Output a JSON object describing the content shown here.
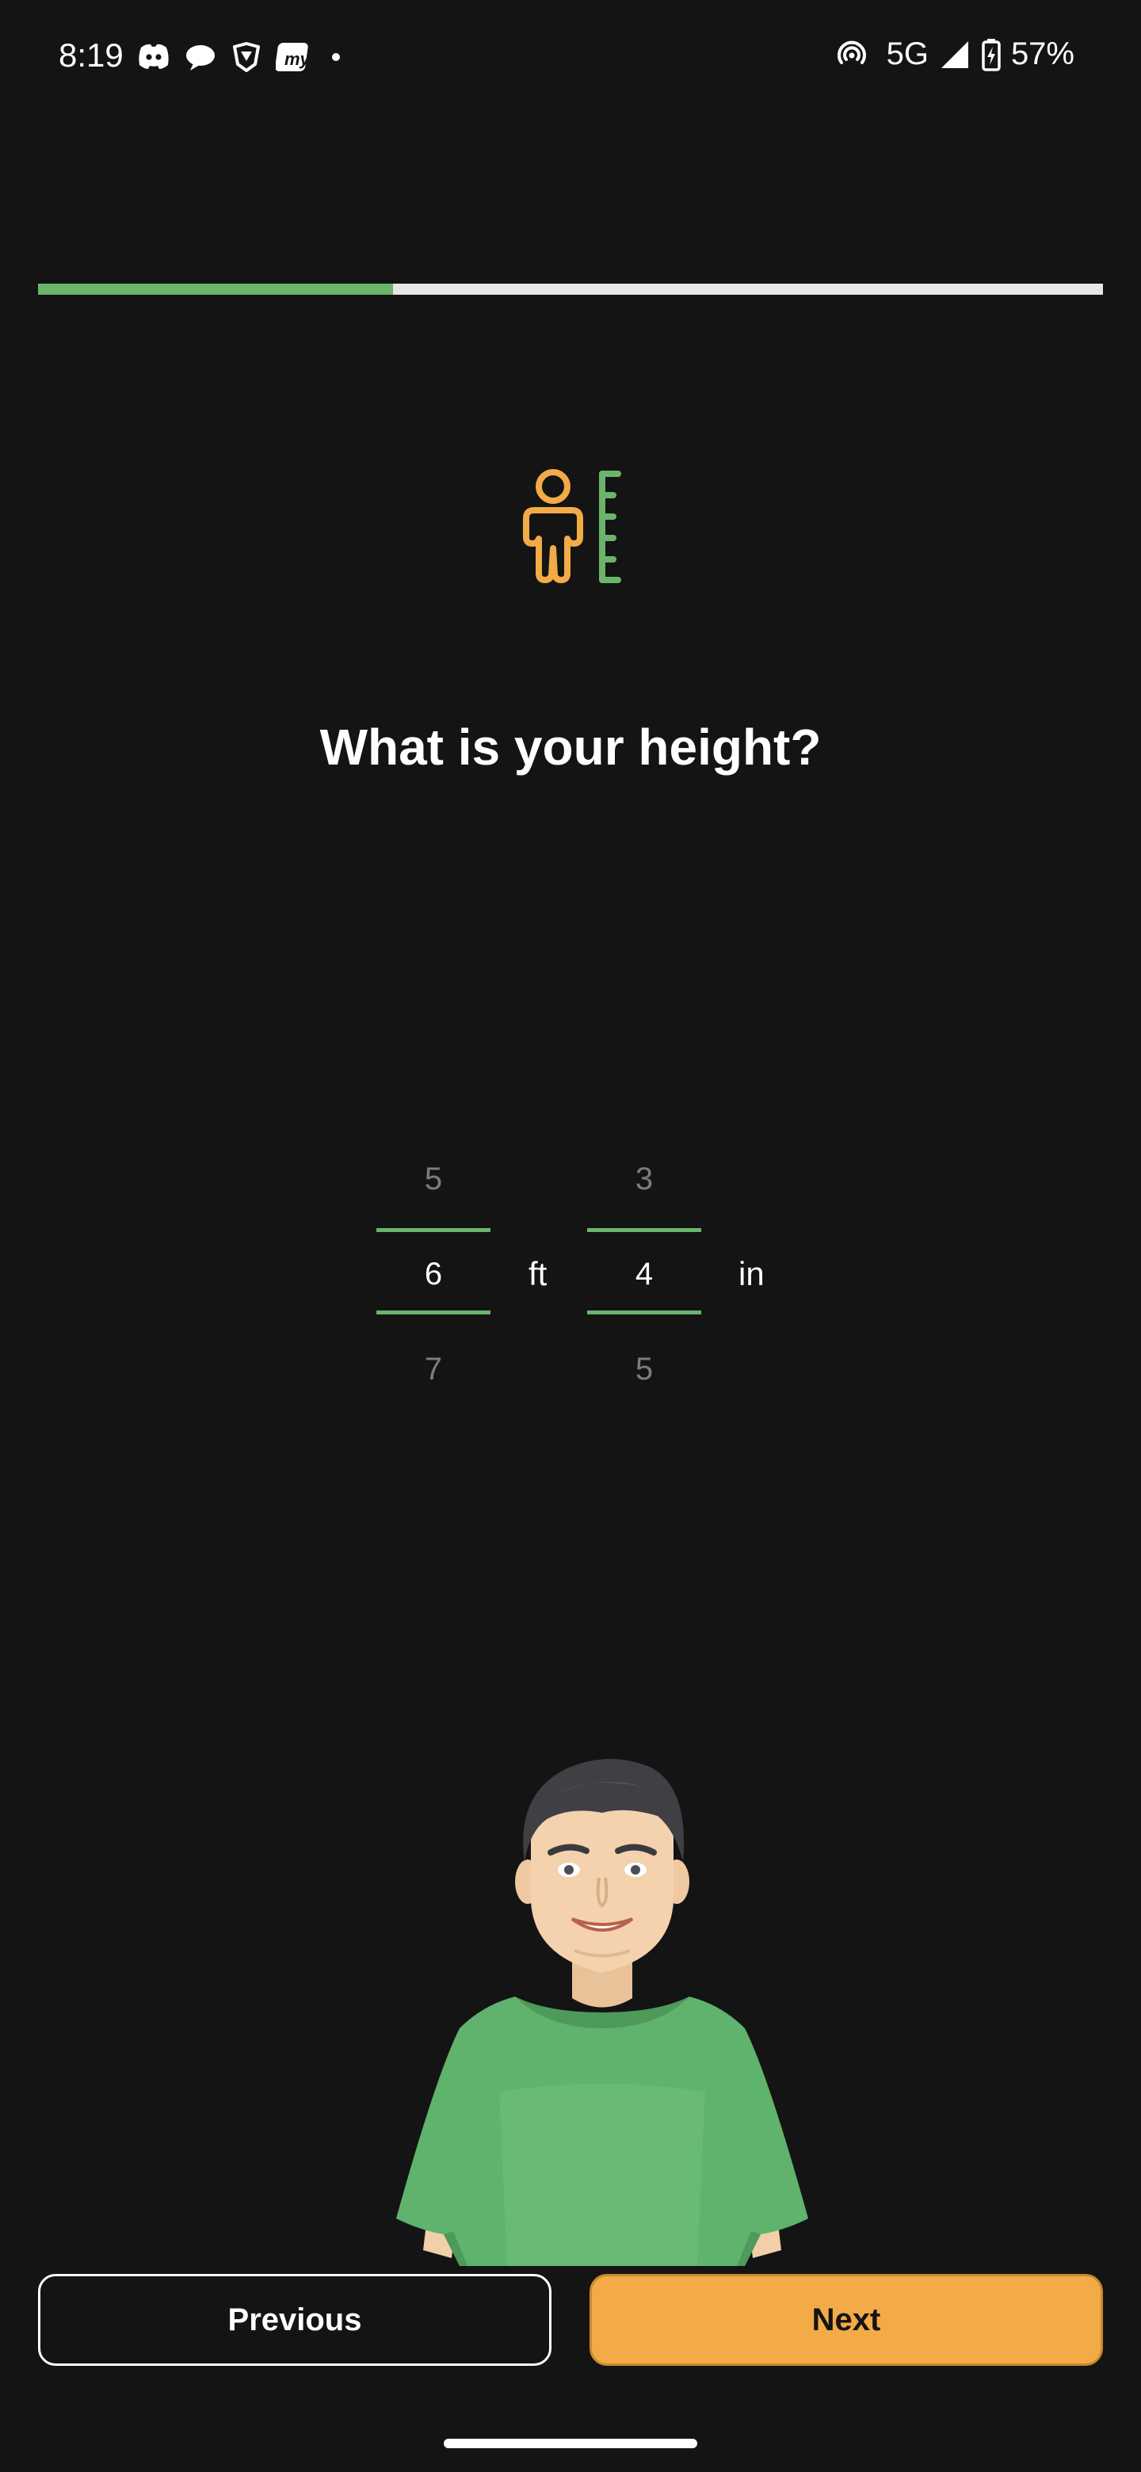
{
  "status_bar": {
    "time": "8:19",
    "left_icons": [
      "discord-icon",
      "chat-bubble-icon",
      "brave-browser-icon",
      "myntra-icon",
      "notification-dot-icon"
    ],
    "network": "5G",
    "battery": "57%",
    "right_icons": [
      "hotspot-icon",
      "cell-signal-icon",
      "battery-charging-icon"
    ]
  },
  "progress": {
    "fraction": 0.333
  },
  "question": {
    "title": "What is your height?"
  },
  "height_picker": {
    "feet": {
      "above": "5",
      "selected": "6",
      "below": "7",
      "unit": "ft"
    },
    "inches": {
      "above": "3",
      "selected": "4",
      "below": "5",
      "unit": "in"
    }
  },
  "buttons": {
    "previous_label": "Previous",
    "next_label": "Next"
  },
  "colors": {
    "background": "#141414",
    "accent_green": "#6ab46b",
    "accent_orange": "#f2ab47",
    "dim_text": "#7c7c7c"
  }
}
